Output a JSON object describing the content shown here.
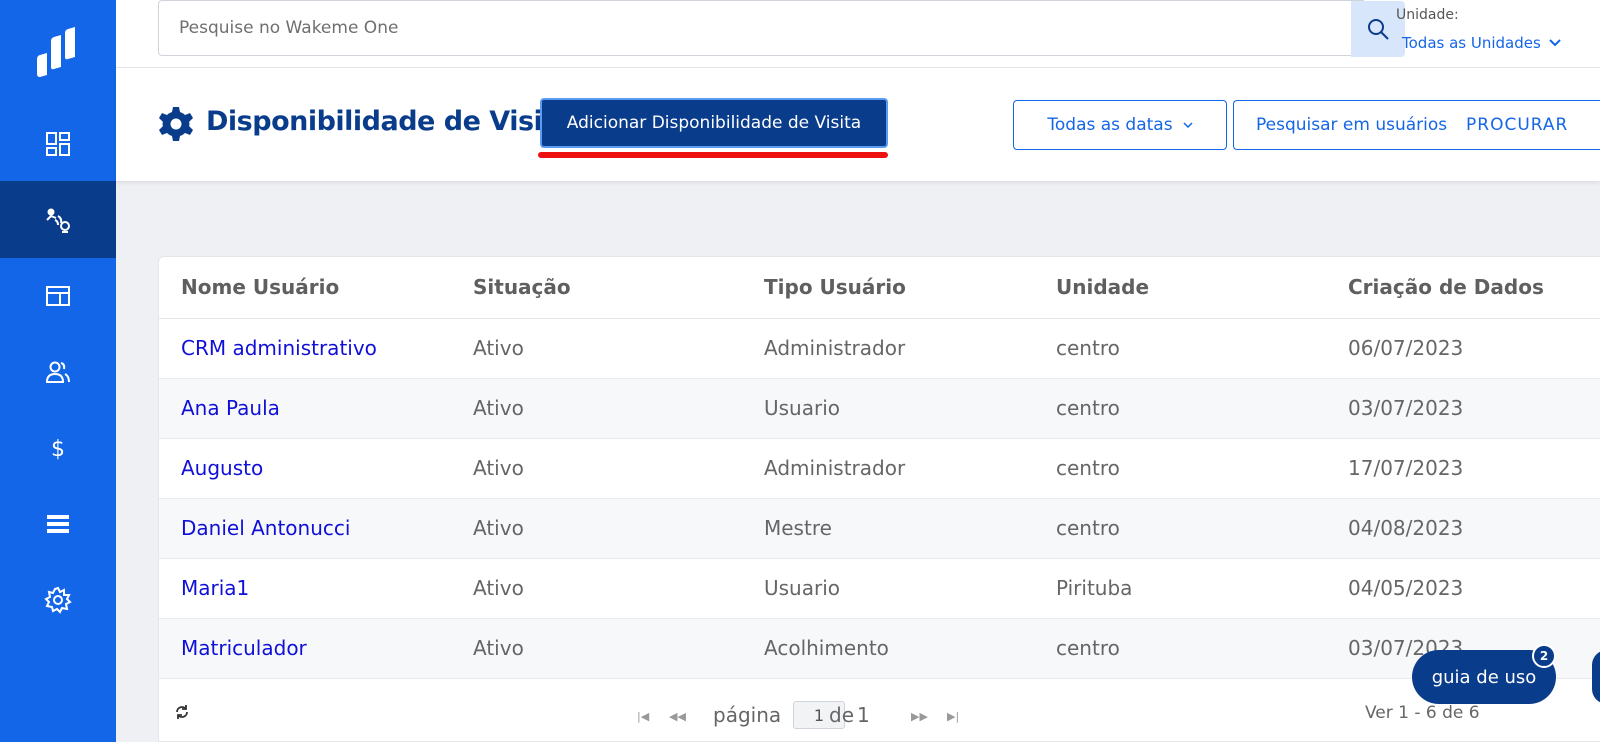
{
  "search": {
    "placeholder": "Pesquise no Wakeme One"
  },
  "unit": {
    "label": "Unidade:",
    "selected": "Todas as Unidades"
  },
  "page": {
    "title": "Disponibilidade de Visita"
  },
  "actions": {
    "add_label": "Adicionar Disponibilidade de Visita",
    "dates_label": "Todas as datas",
    "user_search_label": "Pesquisar em usuários",
    "user_search_button": "PROCURAR"
  },
  "sidebar": {
    "items": [
      {
        "name": "dashboard",
        "icon": "dashboard-icon",
        "active": false
      },
      {
        "name": "visits",
        "icon": "visit-availability-icon",
        "active": true
      },
      {
        "name": "panel",
        "icon": "layout-icon",
        "active": false
      },
      {
        "name": "users",
        "icon": "users-icon",
        "active": false
      },
      {
        "name": "finance",
        "icon": "dollar-icon",
        "active": false
      },
      {
        "name": "list",
        "icon": "list-icon",
        "active": false
      },
      {
        "name": "settings",
        "icon": "gear-icon",
        "active": false
      }
    ]
  },
  "table": {
    "columns": [
      "Nome Usuário",
      "Situação",
      "Tipo Usuário",
      "Unidade",
      "Criação de Dados"
    ],
    "rows": [
      [
        "CRM administrativo",
        "Ativo",
        "Administrador",
        "centro",
        "06/07/2023"
      ],
      [
        "Ana Paula",
        "Ativo",
        "Usuario",
        "centro",
        "03/07/2023"
      ],
      [
        "Augusto",
        "Ativo",
        "Administrador",
        "centro",
        "17/07/2023"
      ],
      [
        "Daniel Antonucci",
        "Ativo",
        "Mestre",
        "centro",
        "04/08/2023"
      ],
      [
        "Maria1",
        "Ativo",
        "Usuario",
        "Pirituba",
        "04/05/2023"
      ],
      [
        "Matriculador",
        "Ativo",
        "Acolhimento",
        "centro",
        "03/07/2023"
      ]
    ]
  },
  "pager": {
    "page_label": "página",
    "current_page": "1",
    "of_label": "de",
    "total_pages": "1",
    "records": "Ver 1 - 6 de 6"
  },
  "guide": {
    "label": "guia de uso",
    "badge": "2"
  },
  "colors": {
    "sidebar": "#1466e8",
    "active": "#0a3c8c",
    "link": "#1010d8",
    "highlight": "#e11111"
  }
}
